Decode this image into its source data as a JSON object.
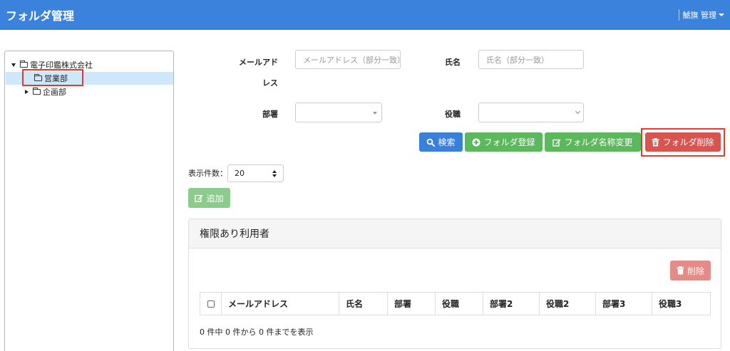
{
  "navbar": {
    "title": "フォルダ管理",
    "user": "鯱旗 管理"
  },
  "tree": {
    "root": "電子印鑑株式会社",
    "children": [
      {
        "label": "営業部",
        "selected": true
      },
      {
        "label": "企画部",
        "selected": false
      }
    ]
  },
  "form": {
    "email_label_1": "メールアド",
    "email_label_2": "レス",
    "email_placeholder": "メールアドレス（部分一致）",
    "name_label": "氏名",
    "name_placeholder": "氏名（部分一致）",
    "dept_label": "部署",
    "dept_value": "",
    "role_label": "役職",
    "role_value": ""
  },
  "buttons": {
    "search": "検索",
    "folder_register": "フォルダ登録",
    "folder_rename": "フォルダ名称変更",
    "folder_delete": "フォルダ削除",
    "add": "追加",
    "delete": "削除"
  },
  "page_size": {
    "label": "表示件数：",
    "value": "20"
  },
  "users_panel": {
    "title": "権限あり利用者",
    "columns": [
      "メールアドレス",
      "氏名",
      "部署",
      "役職",
      "部署2",
      "役職2",
      "部署3",
      "役職3"
    ],
    "footer": "0 件中 0 件から 0 件までを表示"
  },
  "colors": {
    "navbar": "#3a82dc",
    "primary": "#3a7fd9",
    "success": "#5cb85c",
    "danger": "#d9534f",
    "highlight": "#e53b2c",
    "selected_row": "#cfe7fa"
  }
}
